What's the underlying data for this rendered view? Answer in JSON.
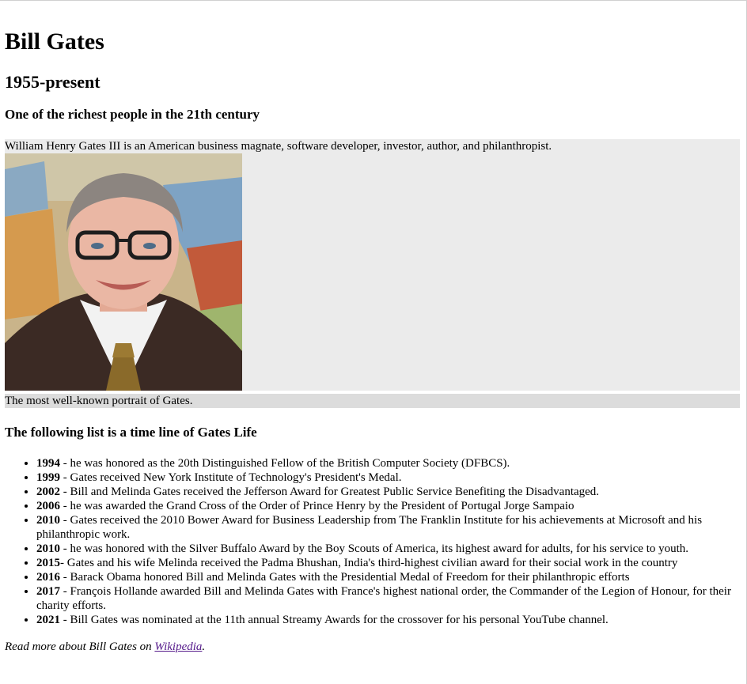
{
  "header": {
    "title": "Bill Gates",
    "years": "1955-present",
    "tagline": "One of the richest people in the 21th century"
  },
  "figure": {
    "intro": "William Henry Gates III is an American business magnate, software developer, investor, author, and philanthropist.",
    "caption": "The most well-known portrait of Gates."
  },
  "timeline": {
    "heading": "The following list is a time line of Gates Life",
    "items": [
      {
        "year": "1994",
        "sep": " - ",
        "text": "he was honored as the 20th Distinguished Fellow of the British Computer Society (DFBCS)."
      },
      {
        "year": "1999",
        "sep": " - ",
        "text": "Gates received New York Institute of Technology's President's Medal."
      },
      {
        "year": "2002",
        "sep": " - ",
        "text": "Bill and Melinda Gates received the Jefferson Award for Greatest Public Service Benefiting the Disadvantaged."
      },
      {
        "year": "2006",
        "sep": " - ",
        "text": "he was awarded the Grand Cross of the Order of Prince Henry by the President of Portugal Jorge Sampaio"
      },
      {
        "year": "2010",
        "sep": " - ",
        "text": "Gates received the 2010 Bower Award for Business Leadership from The Franklin Institute for his achievements at Microsoft and his philanthropic work."
      },
      {
        "year": "2010",
        "sep": " - ",
        "text": "he was honored with the Silver Buffalo Award by the Boy Scouts of America, its highest award for adults, for his service to youth."
      },
      {
        "year": "2015",
        "sep": "- ",
        "text": "Gates and his wife Melinda received the Padma Bhushan, India's third-highest civilian award for their social work in the country"
      },
      {
        "year": "2016",
        "sep": " - ",
        "text": "Barack Obama honored Bill and Melinda Gates with the Presidential Medal of Freedom for their philanthropic efforts"
      },
      {
        "year": "2017",
        "sep": " - ",
        "text": "François Hollande awarded Bill and Melinda Gates with France's highest national order, the Commander of the Legion of Honour, for their charity efforts."
      },
      {
        "year": "2021",
        "sep": " - ",
        "text": "Bill Gates was nominated at the 11th annual Streamy Awards for the crossover for his personal YouTube channel."
      }
    ]
  },
  "footer": {
    "prefix": "Read more about Bill Gates on ",
    "link_text": "Wikipedia",
    "suffix": "."
  },
  "colors": {
    "figure_bg": "#ebebeb",
    "caption_bg": "#dcdcdc",
    "visited_link": "#551a8b"
  }
}
